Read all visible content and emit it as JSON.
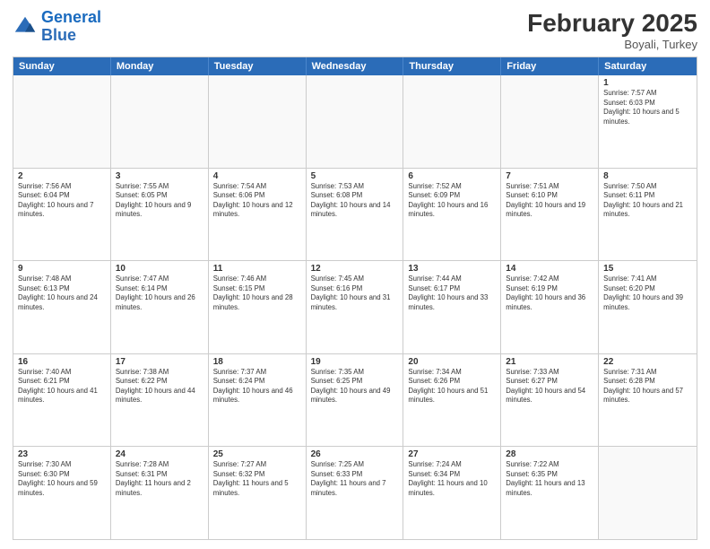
{
  "logo": {
    "line1": "General",
    "line2": "Blue"
  },
  "title": "February 2025",
  "location": "Boyali, Turkey",
  "days_of_week": [
    "Sunday",
    "Monday",
    "Tuesday",
    "Wednesday",
    "Thursday",
    "Friday",
    "Saturday"
  ],
  "rows": [
    [
      {
        "day": "",
        "info": ""
      },
      {
        "day": "",
        "info": ""
      },
      {
        "day": "",
        "info": ""
      },
      {
        "day": "",
        "info": ""
      },
      {
        "day": "",
        "info": ""
      },
      {
        "day": "",
        "info": ""
      },
      {
        "day": "1",
        "info": "Sunrise: 7:57 AM\nSunset: 6:03 PM\nDaylight: 10 hours and 5 minutes."
      }
    ],
    [
      {
        "day": "2",
        "info": "Sunrise: 7:56 AM\nSunset: 6:04 PM\nDaylight: 10 hours and 7 minutes."
      },
      {
        "day": "3",
        "info": "Sunrise: 7:55 AM\nSunset: 6:05 PM\nDaylight: 10 hours and 9 minutes."
      },
      {
        "day": "4",
        "info": "Sunrise: 7:54 AM\nSunset: 6:06 PM\nDaylight: 10 hours and 12 minutes."
      },
      {
        "day": "5",
        "info": "Sunrise: 7:53 AM\nSunset: 6:08 PM\nDaylight: 10 hours and 14 minutes."
      },
      {
        "day": "6",
        "info": "Sunrise: 7:52 AM\nSunset: 6:09 PM\nDaylight: 10 hours and 16 minutes."
      },
      {
        "day": "7",
        "info": "Sunrise: 7:51 AM\nSunset: 6:10 PM\nDaylight: 10 hours and 19 minutes."
      },
      {
        "day": "8",
        "info": "Sunrise: 7:50 AM\nSunset: 6:11 PM\nDaylight: 10 hours and 21 minutes."
      }
    ],
    [
      {
        "day": "9",
        "info": "Sunrise: 7:48 AM\nSunset: 6:13 PM\nDaylight: 10 hours and 24 minutes."
      },
      {
        "day": "10",
        "info": "Sunrise: 7:47 AM\nSunset: 6:14 PM\nDaylight: 10 hours and 26 minutes."
      },
      {
        "day": "11",
        "info": "Sunrise: 7:46 AM\nSunset: 6:15 PM\nDaylight: 10 hours and 28 minutes."
      },
      {
        "day": "12",
        "info": "Sunrise: 7:45 AM\nSunset: 6:16 PM\nDaylight: 10 hours and 31 minutes."
      },
      {
        "day": "13",
        "info": "Sunrise: 7:44 AM\nSunset: 6:17 PM\nDaylight: 10 hours and 33 minutes."
      },
      {
        "day": "14",
        "info": "Sunrise: 7:42 AM\nSunset: 6:19 PM\nDaylight: 10 hours and 36 minutes."
      },
      {
        "day": "15",
        "info": "Sunrise: 7:41 AM\nSunset: 6:20 PM\nDaylight: 10 hours and 39 minutes."
      }
    ],
    [
      {
        "day": "16",
        "info": "Sunrise: 7:40 AM\nSunset: 6:21 PM\nDaylight: 10 hours and 41 minutes."
      },
      {
        "day": "17",
        "info": "Sunrise: 7:38 AM\nSunset: 6:22 PM\nDaylight: 10 hours and 44 minutes."
      },
      {
        "day": "18",
        "info": "Sunrise: 7:37 AM\nSunset: 6:24 PM\nDaylight: 10 hours and 46 minutes."
      },
      {
        "day": "19",
        "info": "Sunrise: 7:35 AM\nSunset: 6:25 PM\nDaylight: 10 hours and 49 minutes."
      },
      {
        "day": "20",
        "info": "Sunrise: 7:34 AM\nSunset: 6:26 PM\nDaylight: 10 hours and 51 minutes."
      },
      {
        "day": "21",
        "info": "Sunrise: 7:33 AM\nSunset: 6:27 PM\nDaylight: 10 hours and 54 minutes."
      },
      {
        "day": "22",
        "info": "Sunrise: 7:31 AM\nSunset: 6:28 PM\nDaylight: 10 hours and 57 minutes."
      }
    ],
    [
      {
        "day": "23",
        "info": "Sunrise: 7:30 AM\nSunset: 6:30 PM\nDaylight: 10 hours and 59 minutes."
      },
      {
        "day": "24",
        "info": "Sunrise: 7:28 AM\nSunset: 6:31 PM\nDaylight: 11 hours and 2 minutes."
      },
      {
        "day": "25",
        "info": "Sunrise: 7:27 AM\nSunset: 6:32 PM\nDaylight: 11 hours and 5 minutes."
      },
      {
        "day": "26",
        "info": "Sunrise: 7:25 AM\nSunset: 6:33 PM\nDaylight: 11 hours and 7 minutes."
      },
      {
        "day": "27",
        "info": "Sunrise: 7:24 AM\nSunset: 6:34 PM\nDaylight: 11 hours and 10 minutes."
      },
      {
        "day": "28",
        "info": "Sunrise: 7:22 AM\nSunset: 6:35 PM\nDaylight: 11 hours and 13 minutes."
      },
      {
        "day": "",
        "info": ""
      }
    ]
  ]
}
